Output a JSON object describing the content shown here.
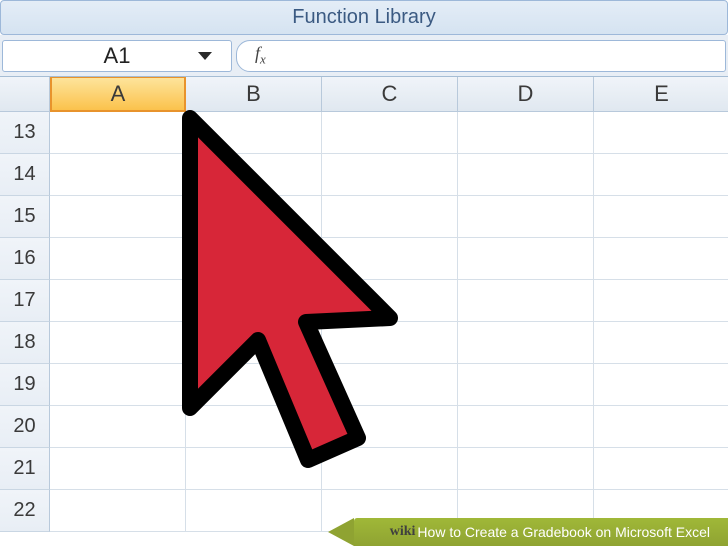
{
  "ribbon": {
    "section_label": "Function Library"
  },
  "formula_bar": {
    "name_box_value": "A1",
    "fx_label": "fx",
    "formula_value": ""
  },
  "grid": {
    "columns": [
      "A",
      "B",
      "C",
      "D",
      "E"
    ],
    "selected_column_index": 0,
    "rows": [
      "13",
      "14",
      "15",
      "16",
      "17",
      "18",
      "19",
      "20",
      "21",
      "22"
    ]
  },
  "banner": {
    "brand": "wiki",
    "text": "How to Create a Gradebook on Microsoft Excel"
  },
  "colors": {
    "ribbon_bg": "#dbe7f3",
    "header_bg": "#e8eef5",
    "selected_col": "#fbc24c",
    "cursor_fill": "#d72638",
    "cursor_stroke": "#000000",
    "banner_bg": "#8fa332"
  }
}
